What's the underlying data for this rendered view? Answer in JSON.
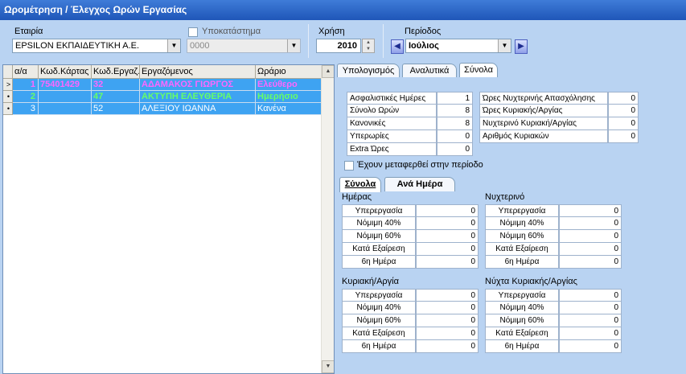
{
  "window": {
    "title": "Ωρομέτρηση / Έλεγχος Ωρών Εργασίας"
  },
  "filters": {
    "company_label": "Εταιρία",
    "company_value": "EPSILON ΕΚΠΑΙΔΕΥΤΙΚΗ Α.Ε.",
    "branch_label": "Υποκατάστημα",
    "branch_value": "0000",
    "year_label": "Χρήση",
    "year_value": "2010",
    "period_label": "Περίοδος",
    "period_value": "Ιούλιος"
  },
  "grid": {
    "headers": [
      "α/α",
      "Κωδ.Κάρτας",
      "Κωδ.Εργαζ.",
      "Εργαζόμενος",
      "Ωράριο"
    ],
    "rows": [
      {
        "indicator": ">",
        "aa": "1",
        "card": "75401429",
        "code": "32",
        "name": "ΑΔΑΜΑΚΟΣ ΓΙΩΡΓΟΣ",
        "schedule": "Ελεύθερο",
        "color": "#ff66ff"
      },
      {
        "indicator": "•",
        "aa": "2",
        "card": "",
        "code": "47",
        "name": "ΑΚΤΥΠΗ ΕΛΕΥΘΕΡΙΑ",
        "schedule": "Ημερήσιο",
        "color": "#66ff66"
      },
      {
        "indicator": "•",
        "aa": "3",
        "card": "",
        "code": "52",
        "name": "ΑΛΕΞΙΟΥ ΙΩΑΝΝΑ",
        "schedule": "Κανένα",
        "color": "#ffffff"
      }
    ]
  },
  "tabs": [
    "Υπολογισμός",
    "Αναλυτικά",
    "Σύνολα"
  ],
  "summary": {
    "left": [
      {
        "label": "Ασφαλιστικές Ημέρες",
        "value": "1"
      },
      {
        "label": "Σύνολο Ωρών",
        "value": "8"
      },
      {
        "label": "Κανονικές",
        "value": "8"
      },
      {
        "label": "Υπερωρίες",
        "value": "0"
      },
      {
        "label": "Extra Ώρες",
        "value": "0"
      }
    ],
    "right": [
      {
        "label": "Ώρες Νυχτερινής Απασχόλησης",
        "value": "0"
      },
      {
        "label": "Ώρες Κυριακής/Αργίας",
        "value": "0"
      },
      {
        "label": "Νυχτερινό Κυριακή/Αργίας",
        "value": "0"
      },
      {
        "label": "Αριθμός Κυριακών",
        "value": "0"
      }
    ],
    "transferred_label": "Έχουν μεταφερθεί στην περίοδο"
  },
  "subtabs": [
    "Σύνολα",
    "Ανά Ημέρα"
  ],
  "groups": [
    {
      "title": "Ημέρας",
      "rows": [
        {
          "label": "Υπερεργασία",
          "value": "0"
        },
        {
          "label": "Νόμιμη 40%",
          "value": "0"
        },
        {
          "label": "Νόμιμη 60%",
          "value": "0"
        },
        {
          "label": "Κατά Εξαίρεση",
          "value": "0"
        },
        {
          "label": "6η Ημέρα",
          "value": "0"
        }
      ]
    },
    {
      "title": "Νυχτερινό",
      "rows": [
        {
          "label": "Υπερεργασία",
          "value": "0"
        },
        {
          "label": "Νόμιμη 40%",
          "value": "0"
        },
        {
          "label": "Νόμιμη 60%",
          "value": "0"
        },
        {
          "label": "Κατά Εξαίρεση",
          "value": "0"
        },
        {
          "label": "6η Ημέρα",
          "value": "0"
        }
      ]
    },
    {
      "title": "Κυριακή/Αργία",
      "rows": [
        {
          "label": "Υπερεργασία",
          "value": "0"
        },
        {
          "label": "Νόμιμη 40%",
          "value": "0"
        },
        {
          "label": "Νόμιμη 60%",
          "value": "0"
        },
        {
          "label": "Κατά Εξαίρεση",
          "value": "0"
        },
        {
          "label": "6η Ημέρα",
          "value": "0"
        }
      ]
    },
    {
      "title": "Νύχτα Κυριακής/Αργίας",
      "rows": [
        {
          "label": "Υπερεργασία",
          "value": "0"
        },
        {
          "label": "Νόμιμη 40%",
          "value": "0"
        },
        {
          "label": "Νόμιμη 60%",
          "value": "0"
        },
        {
          "label": "Κατά Εξαίρεση",
          "value": "0"
        },
        {
          "label": "6η Ημέρα",
          "value": "0"
        }
      ]
    }
  ]
}
